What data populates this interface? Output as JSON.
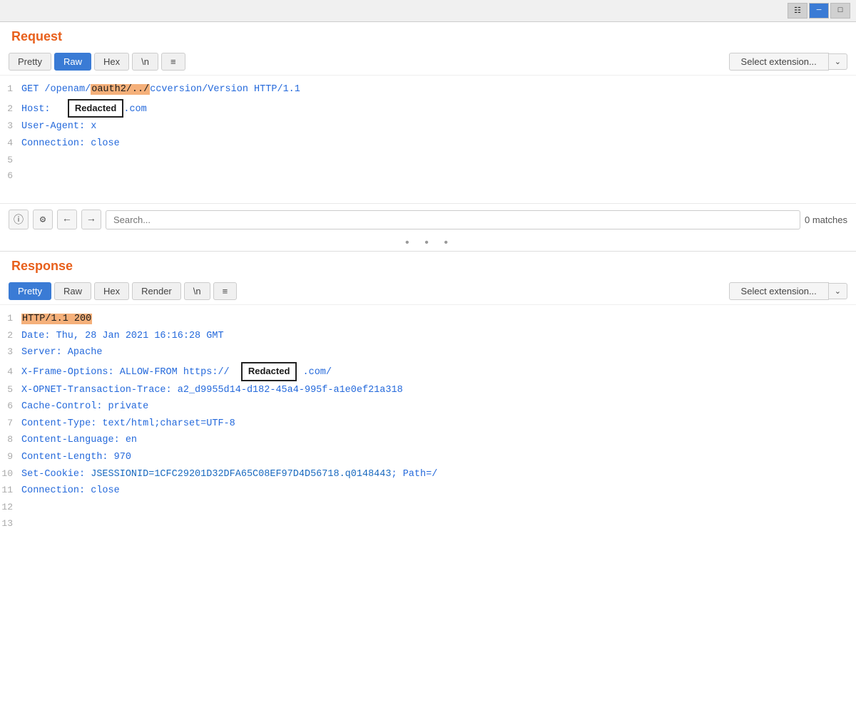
{
  "window": {
    "controls": [
      "grid-icon",
      "minimize-icon",
      "close-icon"
    ]
  },
  "request": {
    "section_title": "Request",
    "tabs": [
      {
        "label": "Pretty",
        "active": false
      },
      {
        "label": "Raw",
        "active": true
      },
      {
        "label": "Hex",
        "active": false
      },
      {
        "label": "\\n",
        "active": false
      },
      {
        "label": "≡",
        "active": false
      }
    ],
    "select_extension": "Select extension...",
    "lines": [
      {
        "num": "1",
        "content": "GET /openam/oauth2/../ccversion/Version HTTP/1.1"
      },
      {
        "num": "2",
        "content": "Host:   .com"
      },
      {
        "num": "3",
        "content": "User-Agent: x"
      },
      {
        "num": "4",
        "content": "Connection: close"
      },
      {
        "num": "5",
        "content": ""
      },
      {
        "num": "6",
        "content": ""
      }
    ],
    "redacted_label": "Redacted"
  },
  "search": {
    "placeholder": "Search...",
    "matches_text": "0 matches"
  },
  "response": {
    "section_title": "Response",
    "tabs": [
      {
        "label": "Pretty",
        "active": true
      },
      {
        "label": "Raw",
        "active": false
      },
      {
        "label": "Hex",
        "active": false
      },
      {
        "label": "Render",
        "active": false
      },
      {
        "label": "\\n",
        "active": false
      },
      {
        "label": "≡",
        "active": false
      }
    ],
    "select_extension": "Select extension...",
    "lines": [
      {
        "num": "1",
        "content": "HTTP/1.1 200"
      },
      {
        "num": "2",
        "content": "Date: Thu, 28 Jan 2021 16:16:28 GMT"
      },
      {
        "num": "3",
        "content": "Server: Apache"
      },
      {
        "num": "4",
        "content": "X-Frame-Options: ALLOW-FROM https://  .com/"
      },
      {
        "num": "5",
        "content": "X-OPNET-Transaction-Trace: a2_d9955d14-d182-45a4-995f-a1e0ef21a318"
      },
      {
        "num": "6",
        "content": "Cache-Control: private"
      },
      {
        "num": "7",
        "content": "Content-Type: text/html;charset=UTF-8"
      },
      {
        "num": "8",
        "content": "Content-Language: en"
      },
      {
        "num": "9",
        "content": "Content-Length: 970"
      },
      {
        "num": "10",
        "content": "Set-Cookie: JSESSIONID=1CFC29201D32DFA65C08EF97D4D56718.q0148443; Path=/"
      },
      {
        "num": "11",
        "content": "Connection: close"
      },
      {
        "num": "12",
        "content": ""
      },
      {
        "num": "13",
        "content": ""
      }
    ],
    "redacted_label": "Redacted"
  }
}
